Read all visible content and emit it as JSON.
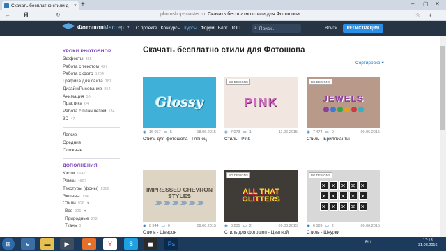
{
  "browser": {
    "tab_title": "Скачать бесплатно стили д",
    "tab_close": "×",
    "new_tab": "+",
    "back": "←",
    "yandex": "Я",
    "url_domain": "photoshop-master.ru",
    "url_page_title": "Скачать бесплатно стили для Фотошопа",
    "win_min": "–",
    "win_max": "▢",
    "win_close": "✕",
    "star": "☆",
    "download": "⭳",
    "reload": "↻"
  },
  "header": {
    "logo_main": "Фотошоп",
    "logo_sub": "Мастер",
    "nav": [
      {
        "label": "О проекте",
        "active": false
      },
      {
        "label": "Конкурсы",
        "active": false
      },
      {
        "label": "Курсы",
        "active": true
      },
      {
        "label": "Форум",
        "active": false
      },
      {
        "label": "Блог",
        "active": false
      },
      {
        "label": "ТОП",
        "active": false
      }
    ],
    "search_placeholder": "Поиск...",
    "search_icon": "⌕",
    "login": "Войти",
    "register": "РЕГИСТРАЦИЯ"
  },
  "sidebar": {
    "heading_lessons": "УРОКИ PHOTOSHOP",
    "lessons": [
      {
        "label": "Эффекты",
        "count": "865"
      },
      {
        "label": "Работа с текстом",
        "count": "427"
      },
      {
        "label": "Работа с фото",
        "count": "1204"
      },
      {
        "label": "Графика для сайта",
        "count": "181"
      },
      {
        "label": "Дизайн/Рисование",
        "count": "854"
      },
      {
        "label": "Анимация",
        "count": "56"
      },
      {
        "label": "Практика",
        "count": "64"
      },
      {
        "label": "Работа с планшетом",
        "count": "134"
      },
      {
        "label": "3D",
        "count": "47"
      }
    ],
    "levels": [
      "Легкие",
      "Средние",
      "Сложные"
    ],
    "heading_extras": "ДОПОЛНЕНИЯ",
    "extras": [
      {
        "label": "Кисти",
        "count": "1642",
        "sub": false
      },
      {
        "label": "Рамки",
        "count": "4897",
        "sub": false
      },
      {
        "label": "Текстуры (фоны)",
        "count": "1316",
        "sub": false
      },
      {
        "label": "Экшены",
        "count": "134",
        "sub": false
      },
      {
        "label": "Стили",
        "count": "926",
        "sub": false,
        "caret": "▼"
      },
      {
        "label": "Все",
        "count": "926",
        "sub": true,
        "caret": "▼"
      },
      {
        "label": "Природные",
        "count": "272",
        "sub": true
      },
      {
        "label": "Ткань",
        "count": "6",
        "sub": true
      }
    ]
  },
  "main": {
    "title": "Скачать бесплатно стили для Фотошопа",
    "sort_label": "Сортировка ▾",
    "cards": [
      {
        "views": "16 057",
        "comments": "5",
        "date": "18.06.2015",
        "title": "Стиль для фотошопа - Глянец",
        "thumb_text": "Glossy"
      },
      {
        "views": "7 073",
        "comments": "1",
        "date": "11.06.2015",
        "title": "Стиль - Pink",
        "thumb_text": "PINK",
        "badge": "BG DESIGNS"
      },
      {
        "views": "7 474",
        "comments": "0",
        "date": "09.06.2015",
        "title": "Стиль - Бриллианты",
        "thumb_text": "JEWELS",
        "badge": "BG DESIGNS"
      },
      {
        "views": "8 344",
        "comments": "0",
        "date": "09.06.2015",
        "title": "Стиль - Шеврон",
        "thumb_text": "IMPRESSED CHEVRON STYLES"
      },
      {
        "views": "8 235",
        "comments": "2",
        "date": "09.06.2015",
        "title": "Стиль для фотошоп - Цветной",
        "thumb_text": "ALL THAT GLITTERS",
        "badge": "BG DESIGNS"
      },
      {
        "views": "6 589",
        "comments": "2",
        "date": "06.06.2015",
        "title": "Стиль - Шнурки",
        "badge": "BG DESIGNS"
      }
    ],
    "icons": {
      "views": "◉",
      "comments": "▭"
    }
  },
  "taskbar": {
    "start": "⊞",
    "tray_lang": "RU",
    "time": "17:13",
    "date": "31.08.2016"
  },
  "colors": {
    "header_bg": "#273444",
    "accent": "#2b8fe5",
    "sidebar_heading": "#7a3fbf",
    "taskbar_bg": "#1c3a5b"
  }
}
